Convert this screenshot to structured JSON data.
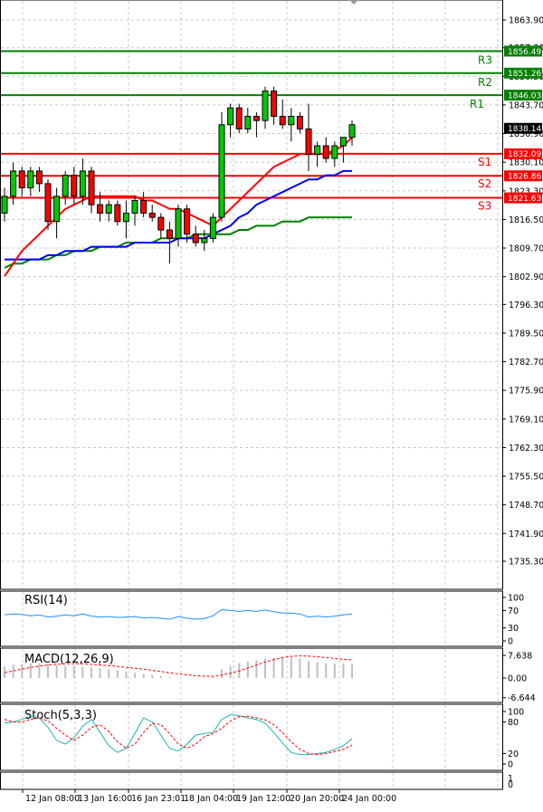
{
  "chart_data": {
    "type": "candlestick",
    "price_axis": {
      "ticks": [
        "1863.90",
        "1857.30",
        "1850.50",
        "1843.70",
        "1836.90",
        "1830.10",
        "1823.30",
        "1816.50",
        "1809.70",
        "1802.90",
        "1796.30",
        "1789.50",
        "1782.70",
        "1775.90",
        "1769.10",
        "1762.30",
        "1755.50",
        "1748.70",
        "1741.90",
        "1735.30"
      ],
      "range": [
        1733.5,
        1866.5
      ]
    },
    "x_ticks": [
      "12 Jan 08:00",
      "13 Jan 16:00",
      "16 Jan 23:01",
      "18 Jan 04:00",
      "19 Jan 12:00",
      "20 Jan 20:00",
      "24 Jan 00:00"
    ],
    "current_price": {
      "label": "1838.14",
      "value": 1838.14,
      "color": "#000000"
    },
    "levels": [
      {
        "name": "R3",
        "value": 1856.49,
        "tag": "1856.49",
        "color": "#008000"
      },
      {
        "name": "R2",
        "value": 1851.26,
        "tag": "1851.26",
        "color": "#008000"
      },
      {
        "name": "R1",
        "value": 1846.03,
        "tag": "1846.03",
        "color": "#008000"
      },
      {
        "name": "S1",
        "value": 1832.09,
        "tag": "1832.09",
        "color": "#ff0000"
      },
      {
        "name": "S2",
        "value": 1826.86,
        "tag": "1826.86",
        "color": "#ff0000"
      },
      {
        "name": "S3",
        "value": 1821.63,
        "tag": "1821.63",
        "color": "#ff0000"
      }
    ],
    "candles": [
      [
        1818,
        1824,
        1816,
        1822
      ],
      [
        1822,
        1830,
        1820,
        1828
      ],
      [
        1828,
        1829,
        1822,
        1824
      ],
      [
        1824,
        1829,
        1822,
        1828
      ],
      [
        1828,
        1829,
        1823,
        1825
      ],
      [
        1825,
        1826,
        1814,
        1816
      ],
      [
        1816,
        1824,
        1812,
        1822
      ],
      [
        1822,
        1828,
        1820,
        1827
      ],
      [
        1827,
        1829,
        1820,
        1822
      ],
      [
        1822,
        1831,
        1820,
        1828
      ],
      [
        1828,
        1829,
        1818,
        1820
      ],
      [
        1820,
        1823,
        1816,
        1818
      ],
      [
        1818,
        1821,
        1816,
        1820
      ],
      [
        1820,
        1821,
        1815,
        1816
      ],
      [
        1816,
        1821,
        1812,
        1818
      ],
      [
        1818,
        1822,
        1815,
        1821
      ],
      [
        1821,
        1823,
        1817,
        1818
      ],
      [
        1818,
        1820,
        1816,
        1817
      ],
      [
        1817,
        1818,
        1812,
        1814
      ],
      [
        1814,
        1816,
        1806,
        1812
      ],
      [
        1812,
        1820,
        1810,
        1819
      ],
      [
        1819,
        1820,
        1811,
        1813
      ],
      [
        1813,
        1815,
        1810,
        1811
      ],
      [
        1811,
        1814,
        1809,
        1812
      ],
      [
        1812,
        1818,
        1811,
        1817
      ],
      [
        1817,
        1842,
        1816,
        1839
      ],
      [
        1839,
        1844,
        1836,
        1843
      ],
      [
        1843,
        1844,
        1837,
        1838
      ],
      [
        1838,
        1843,
        1837,
        1841
      ],
      [
        1841,
        1842,
        1836,
        1840
      ],
      [
        1840,
        1848,
        1838,
        1847
      ],
      [
        1847,
        1848,
        1839,
        1841
      ],
      [
        1841,
        1845,
        1838,
        1839
      ],
      [
        1839,
        1843,
        1835,
        1841
      ],
      [
        1841,
        1842,
        1837,
        1838
      ],
      [
        1838,
        1844,
        1828,
        1832
      ],
      [
        1832,
        1835,
        1829,
        1834
      ],
      [
        1834,
        1836,
        1830,
        1831
      ],
      [
        1831,
        1835,
        1829,
        1834
      ],
      [
        1834,
        1836,
        1830,
        1836
      ],
      [
        1836,
        1840,
        1834,
        1839
      ]
    ],
    "ma_fast": [
      1803,
      1806,
      1809,
      1811,
      1813,
      1815,
      1817,
      1819,
      1820,
      1821,
      1822,
      1822,
      1822,
      1822,
      1822,
      1822,
      1821,
      1821,
      1820,
      1819,
      1819,
      1818,
      1817,
      1816,
      1815,
      1817,
      1819,
      1821,
      1823,
      1825,
      1827,
      1829,
      1830,
      1831,
      1832,
      1832,
      1832,
      1832,
      1833,
      1834,
      1836
    ],
    "ma_mid": [
      1807,
      1807,
      1807,
      1807,
      1807,
      1808,
      1808,
      1809,
      1809,
      1809,
      1810,
      1810,
      1810,
      1810,
      1810,
      1811,
      1811,
      1811,
      1811,
      1811,
      1812,
      1812,
      1812,
      1812,
      1813,
      1814,
      1815,
      1817,
      1818,
      1820,
      1821,
      1822,
      1823,
      1824,
      1825,
      1826,
      1826,
      1827,
      1827,
      1828,
      1828
    ],
    "ma_slow": [
      1805,
      1806,
      1806,
      1807,
      1807,
      1807,
      1808,
      1808,
      1809,
      1809,
      1809,
      1810,
      1810,
      1810,
      1811,
      1811,
      1811,
      1811,
      1812,
      1812,
      1812,
      1812,
      1813,
      1813,
      1813,
      1813,
      1813,
      1814,
      1814,
      1815,
      1815,
      1815,
      1816,
      1816,
      1816,
      1817,
      1817,
      1817,
      1817,
      1817,
      1817
    ],
    "rsi": {
      "title": "RSI(14)",
      "ticks": [
        "100",
        "70",
        "30",
        "0"
      ],
      "values": [
        60,
        62,
        61,
        58,
        60,
        55,
        57,
        60,
        58,
        62,
        57,
        55,
        56,
        54,
        55,
        56,
        53,
        54,
        52,
        50,
        56,
        52,
        50,
        51,
        58,
        72,
        70,
        68,
        70,
        68,
        71,
        67,
        64,
        64,
        62,
        55,
        57,
        55,
        57,
        60,
        62
      ]
    },
    "macd": {
      "title": "MACD(12,26,9)",
      "ticks": [
        "7.638",
        "0.00",
        "-6.644"
      ],
      "histogram": [
        4.0,
        4.5,
        4.8,
        5.0,
        5.0,
        4.8,
        4.5,
        4.2,
        4.0,
        3.8,
        3.6,
        3.4,
        3.0,
        2.6,
        2.2,
        1.8,
        1.4,
        1.0,
        0.6,
        0.2,
        0.1,
        0.0,
        0.0,
        0.1,
        0.3,
        3.0,
        4.2,
        5.0,
        5.6,
        6.0,
        6.5,
        6.8,
        7.0,
        6.9,
        6.6,
        5.8,
        5.4,
        5.0,
        4.8,
        4.8,
        4.9
      ],
      "signal": [
        1.8,
        2.4,
        3.0,
        3.6,
        4.0,
        4.4,
        4.6,
        4.8,
        4.8,
        4.8,
        4.6,
        4.4,
        4.2,
        3.9,
        3.6,
        3.3,
        3.0,
        2.6,
        2.2,
        1.8,
        1.4,
        1.1,
        0.8,
        0.6,
        0.6,
        1.0,
        1.6,
        2.4,
        3.4,
        4.4,
        5.4,
        6.2,
        6.9,
        7.3,
        7.5,
        7.4,
        7.2,
        6.9,
        6.6,
        6.3,
        6.1
      ]
    },
    "stoch": {
      "title": "Stoch(5,3,3)",
      "ticks": [
        "100",
        "80",
        "20",
        "0"
      ],
      "k": [
        78,
        80,
        85,
        92,
        88,
        70,
        45,
        38,
        50,
        72,
        85,
        60,
        35,
        22,
        30,
        58,
        88,
        80,
        55,
        30,
        25,
        38,
        55,
        58,
        60,
        85,
        94,
        92,
        88,
        85,
        78,
        60,
        40,
        22,
        18,
        18,
        20,
        22,
        28,
        35,
        48
      ],
      "d": [
        85,
        80,
        80,
        85,
        88,
        82,
        68,
        55,
        45,
        55,
        70,
        75,
        62,
        42,
        30,
        38,
        60,
        78,
        75,
        58,
        38,
        30,
        38,
        52,
        58,
        68,
        82,
        90,
        91,
        88,
        84,
        75,
        60,
        42,
        28,
        20,
        18,
        20,
        24,
        28,
        36
      ]
    },
    "bottom_ticks": [
      "1",
      "0"
    ]
  }
}
